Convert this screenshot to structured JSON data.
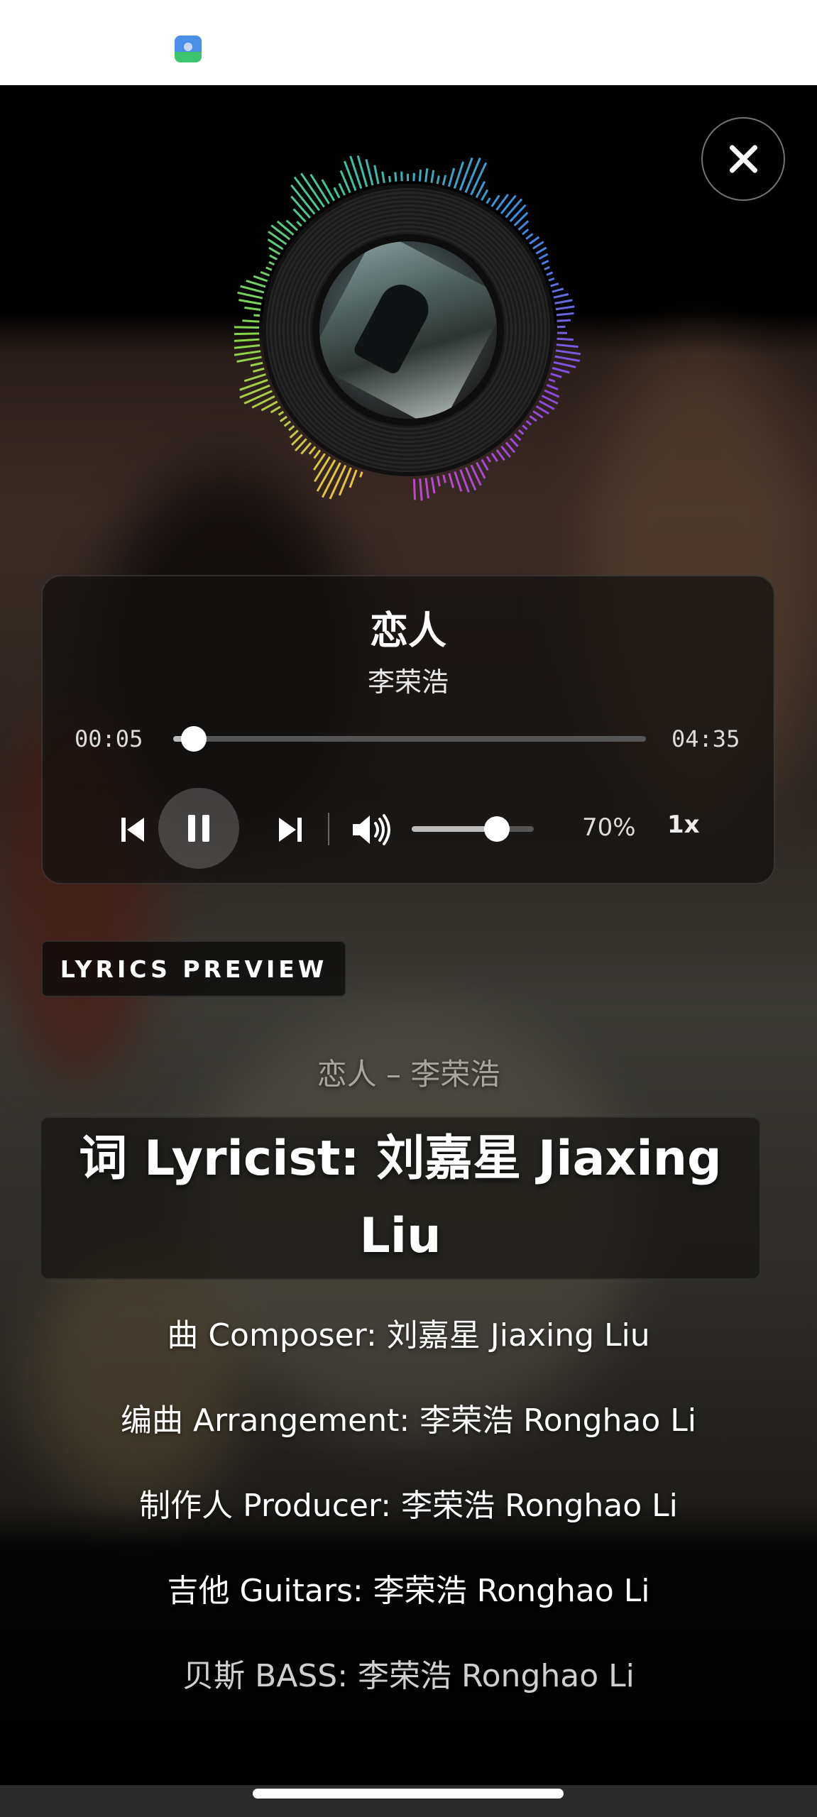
{
  "player": {
    "title": "恋人",
    "artist": "李荣浩",
    "time_current": "00:05",
    "time_total": "04:35",
    "progress_fraction": 0.044,
    "volume_percent_text": "70%",
    "volume_fraction": 0.7,
    "speed_label": "1x",
    "icons": {
      "close": "close-icon",
      "prev": "skip-previous-icon",
      "pause": "pause-icon",
      "next": "skip-next-icon",
      "volume": "volume-icon"
    }
  },
  "lyrics_preview": {
    "label": "LYRICS PREVIEW",
    "header": "恋人 – 李荣浩",
    "current_line": "词 Lyricist: 刘嘉星 Jiaxing Liu",
    "lines": [
      "曲 Composer: 刘嘉星 Jiaxing Liu",
      "编曲 Arrangement: 李荣浩 Ronghao Li",
      "制作人 Producer: 李荣浩 Ronghao Li",
      "吉他 Guitars: 李荣浩 Ronghao Li",
      "贝斯 BASS: 李荣浩 Ronghao Li"
    ]
  },
  "colors": {
    "visualizer_gradient": [
      "#f0c040",
      "#8bd44a",
      "#3cc4a0",
      "#3a8fe0",
      "#8a4adf",
      "#c048c8"
    ]
  }
}
